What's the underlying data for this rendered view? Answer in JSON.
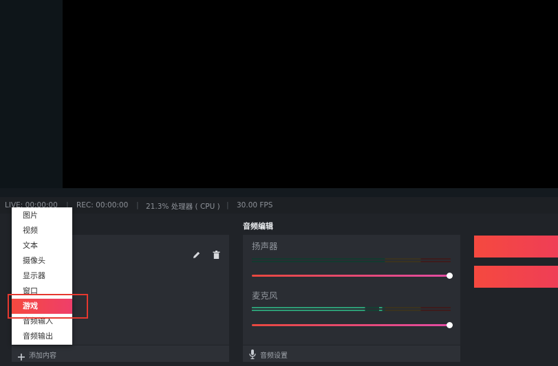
{
  "status_bar": {
    "live": "LIVE: 00:00:00",
    "rec": "REC: 00:00:00",
    "cpu": "21.3% 处理器 ( CPU )",
    "fps": "30.00 FPS",
    "separator": "|"
  },
  "add_menu": {
    "items": [
      "图片",
      "视频",
      "文本",
      "摄像头",
      "显示器",
      "窗口",
      "游戏",
      "音频输入",
      "音频输出"
    ],
    "selected": "游戏"
  },
  "sources": {
    "add_label": "添加内容",
    "icons": [
      "pencil-icon",
      "trash-icon",
      "plus-icon"
    ]
  },
  "audio": {
    "title": "音频编辑",
    "speaker_label": "扬声器",
    "mic_label": "麦克风",
    "speaker_volume": 1.0,
    "mic_volume": 1.0,
    "settings_label": "音频设置",
    "icons": [
      "microphone-icon"
    ]
  },
  "colors": {
    "accent": "#f5493f",
    "highlight_box": "#e5382f",
    "slider_start": "#e8483f",
    "slider_end": "#e34ca4"
  }
}
